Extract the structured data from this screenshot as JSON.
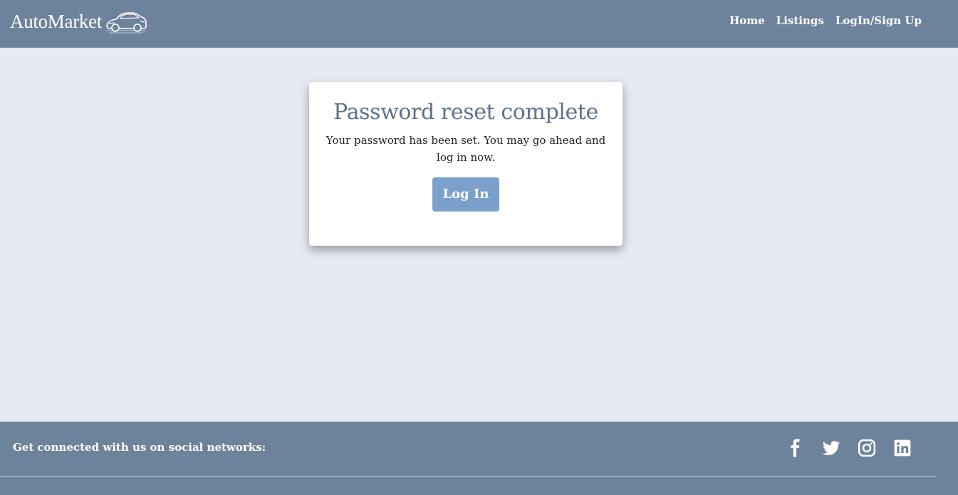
{
  "brand": {
    "name": "AutoMarket",
    "logo_icon": "car-icon"
  },
  "nav": {
    "links": [
      {
        "label": "Home"
      },
      {
        "label": "Listings"
      },
      {
        "label": "LogIn/Sign Up"
      }
    ]
  },
  "card": {
    "title": "Password reset complete",
    "message": "Your password has been set. You may go ahead and log in now.",
    "button_label": "Log In"
  },
  "footer": {
    "text": "Get connected with us on social networks:",
    "social_icons": [
      "facebook-icon",
      "twitter-icon",
      "instagram-icon",
      "linkedin-icon"
    ]
  },
  "colors": {
    "navbar_bg": "#6d839c",
    "page_bg": "#e6eaf2",
    "title_color": "#5e728c",
    "button_bg": "#7aa0cb"
  }
}
